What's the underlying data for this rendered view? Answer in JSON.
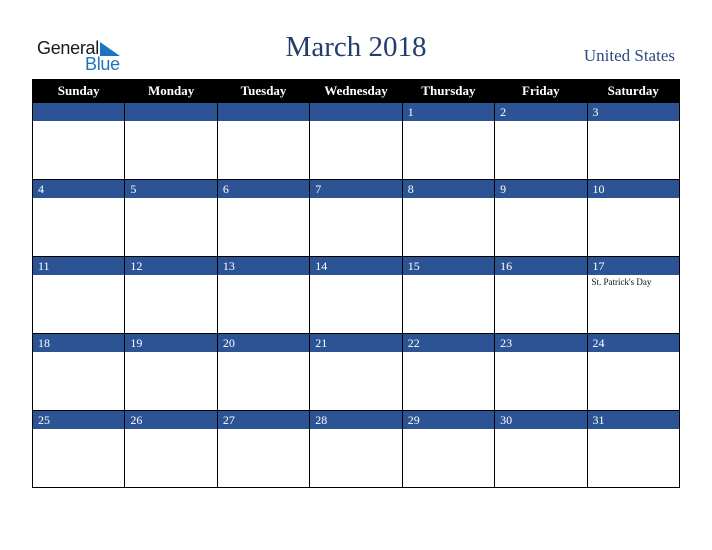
{
  "logo": {
    "word1": "General",
    "word2": "Blue"
  },
  "header": {
    "title": "March 2018",
    "country": "United States"
  },
  "weekdays": [
    "Sunday",
    "Monday",
    "Tuesday",
    "Wednesday",
    "Thursday",
    "Friday",
    "Saturday"
  ],
  "weeks": [
    [
      "",
      "",
      "",
      "",
      "1",
      "2",
      "3"
    ],
    [
      "4",
      "5",
      "6",
      "7",
      "8",
      "9",
      "10"
    ],
    [
      "11",
      "12",
      "13",
      "14",
      "15",
      "16",
      "17"
    ],
    [
      "18",
      "19",
      "20",
      "21",
      "22",
      "23",
      "24"
    ],
    [
      "25",
      "26",
      "27",
      "28",
      "29",
      "30",
      "31"
    ]
  ],
  "holidays": {
    "w2d6": "St. Patrick's Day"
  },
  "colors": {
    "band": "#2c5494",
    "title": "#233e6b",
    "logo_blue": "#1f73bd"
  }
}
